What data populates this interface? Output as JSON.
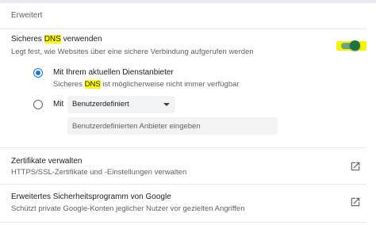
{
  "section": {
    "title": "Erweitert"
  },
  "secure_dns": {
    "title_before": "Sicheres ",
    "title_highlight": "DNS",
    "title_after": " verwenden",
    "description": "Legt fest, wie Websites über eine sichere Verbindung aufgerufen werden",
    "enabled": true,
    "option_current": {
      "label": "Mit Ihrem aktuellen Dienstanbieter",
      "sub_before": "Sicheres ",
      "sub_highlight": "DNS",
      "sub_after": " ist möglicherweise nicht immer verfügbar",
      "selected": true
    },
    "option_custom": {
      "label": "Mit",
      "selected": false,
      "select_value": "Benutzerdefiniert",
      "input_placeholder": "Benutzerdefinierten Anbieter eingeben"
    }
  },
  "certificates": {
    "title": "Zertifikate verwalten",
    "description": "HTTPS/SSL-Zertifikate und -Einstellungen verwalten",
    "icon": "open-in-new-icon"
  },
  "advanced_protection": {
    "title": "Erweitertes Sicherheitsprogramm von Google",
    "description": "Schützt private Google-Konten jeglicher Nutzer vor gezielten Angriffen",
    "icon": "open-in-new-icon"
  },
  "colors": {
    "accent": "#1a73e8",
    "toggle_on": "#1a7340",
    "highlight": "#ffff00"
  }
}
